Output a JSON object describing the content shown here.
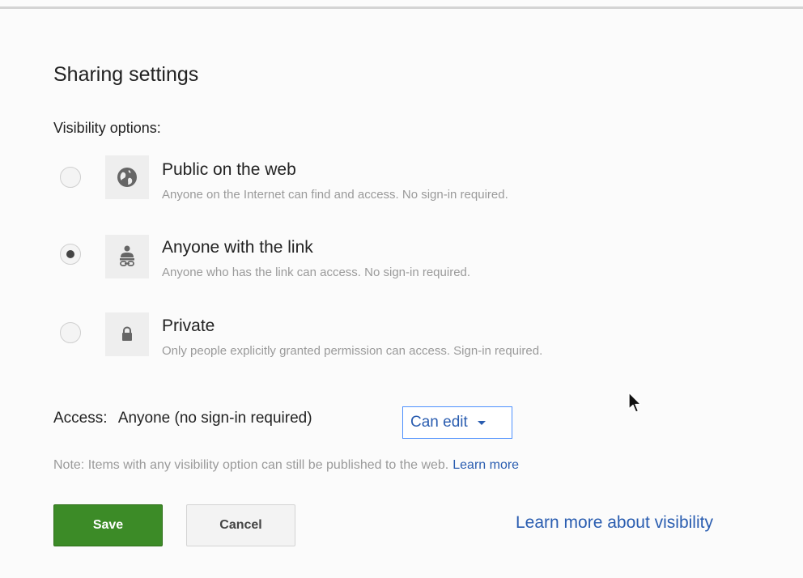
{
  "dialog": {
    "title": "Sharing settings",
    "visibility_label": "Visibility options:"
  },
  "options": [
    {
      "title": "Public on the web",
      "description": "Anyone on the Internet can find and access. No sign-in required.",
      "icon": "globe-icon",
      "selected": false
    },
    {
      "title": "Anyone with the link",
      "description": "Anyone who has the link can access. No sign-in required.",
      "icon": "person-link-icon",
      "selected": true
    },
    {
      "title": "Private",
      "description": "Only people explicitly granted permission can access. Sign-in required.",
      "icon": "lock-icon",
      "selected": false
    }
  ],
  "access": {
    "label": "Access:",
    "value": "Anyone (no sign-in required)",
    "permission": "Can edit"
  },
  "note": {
    "text": "Note: Items with any visibility option can still be published to the web.",
    "link": "Learn more"
  },
  "buttons": {
    "save": "Save",
    "cancel": "Cancel"
  },
  "learn_more_visibility": "Learn more about visibility",
  "colors": {
    "save_green": "#3c8b27",
    "link_blue": "#2a5db0",
    "dropdown_border": "#4d90fe"
  }
}
